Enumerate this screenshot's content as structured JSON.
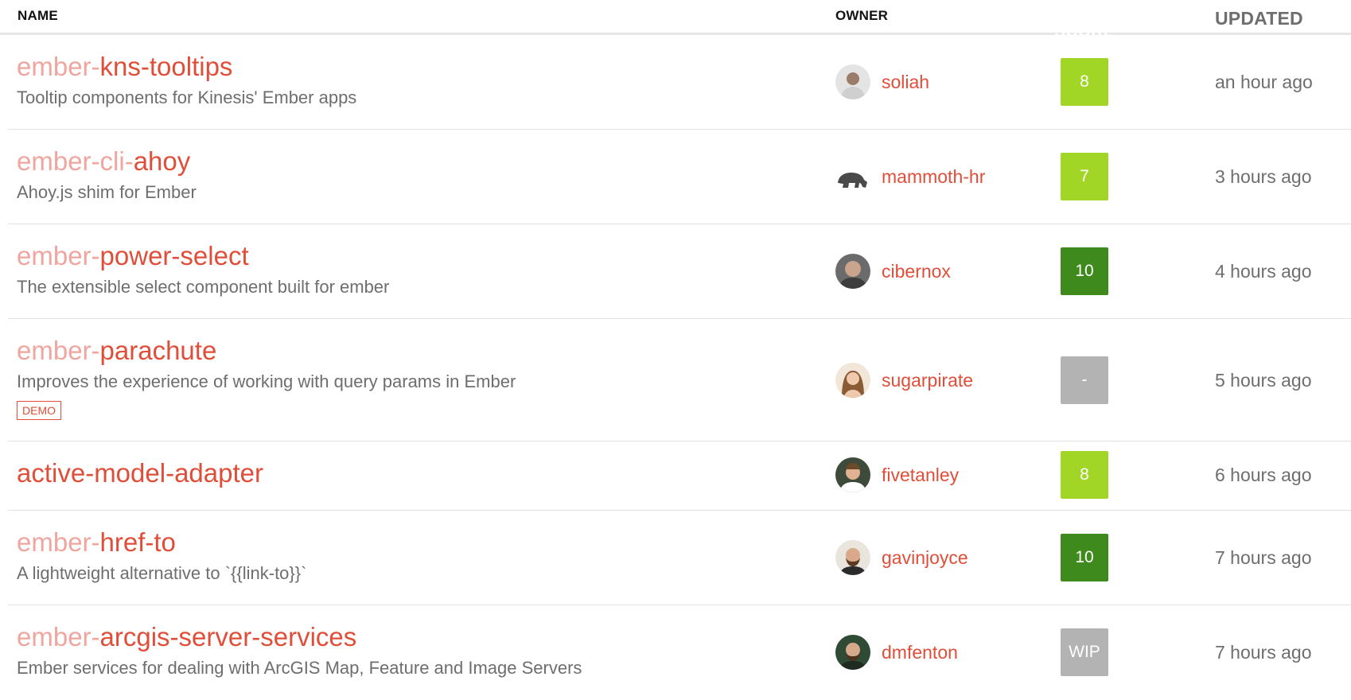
{
  "headers": {
    "name": "NAME",
    "owner": "OWNER",
    "score": "SCORE",
    "updated": "UPDATED"
  },
  "rows": [
    {
      "prefix": "ember-",
      "base": "kns-tooltips",
      "description": "Tooltip components for Kinesis' Ember apps",
      "owner": "soliah",
      "score": "8",
      "score_color": "#a2d626",
      "updated": "an hour ago"
    },
    {
      "prefix": "ember-cli-",
      "base": "ahoy",
      "description": "Ahoy.js shim for Ember",
      "owner": "mammoth-hr",
      "score": "7",
      "score_color": "#a2d626",
      "updated": "3 hours ago"
    },
    {
      "prefix": "ember-",
      "base": "power-select",
      "description": "The extensible select component built for ember",
      "owner": "cibernox",
      "score": "10",
      "score_color": "#3f8a1c",
      "updated": "4 hours ago"
    },
    {
      "prefix": "ember-",
      "base": "parachute",
      "description": "Improves the experience of working with query params in Ember",
      "demo": "DEMO",
      "owner": "sugarpirate",
      "score": "-",
      "score_color": "#b3b3b3",
      "updated": "5 hours ago"
    },
    {
      "prefix": "",
      "base": "active-model-adapter",
      "description": "",
      "owner": "fivetanley",
      "score": "8",
      "score_color": "#a2d626",
      "updated": "6 hours ago"
    },
    {
      "prefix": "ember-",
      "base": "href-to",
      "description": "A lightweight alternative to `{{link-to}}`",
      "owner": "gavinjoyce",
      "score": "10",
      "score_color": "#3f8a1c",
      "updated": "7 hours ago"
    },
    {
      "prefix": "ember-",
      "base": "arcgis-server-services",
      "description": "Ember services for dealing with ArcGIS Map, Feature and Image Servers",
      "owner": "dmfenton",
      "score": "WIP",
      "score_color": "#b3b3b3",
      "updated": "7 hours ago"
    }
  ]
}
